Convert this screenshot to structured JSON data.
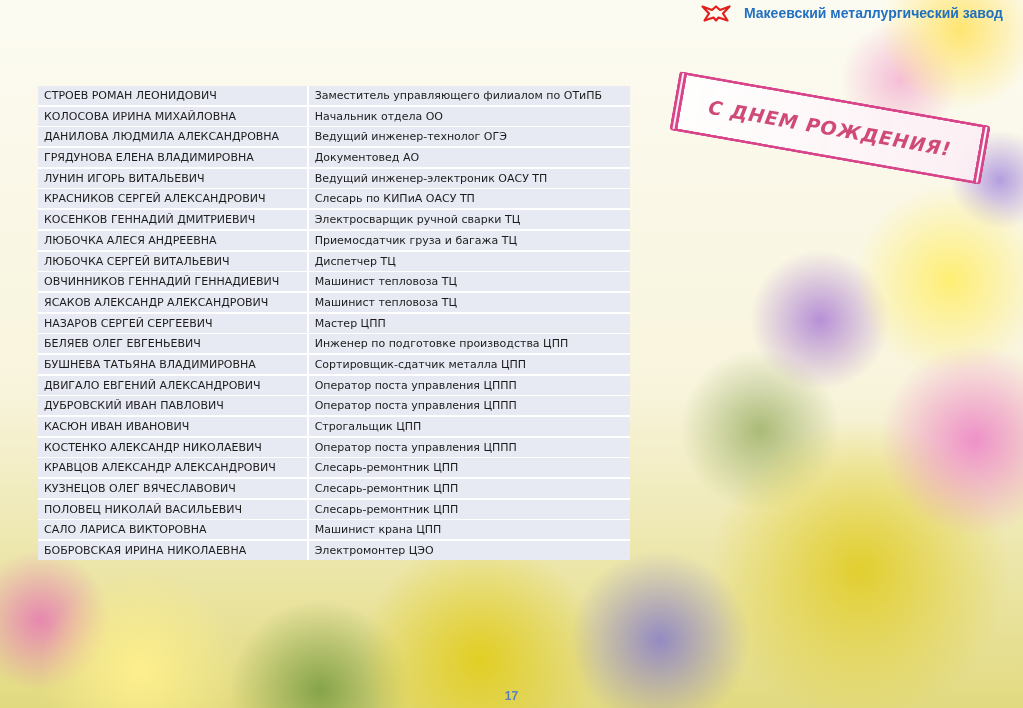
{
  "header": {
    "company": "Макеевский металлургический завод"
  },
  "table": {
    "rows": [
      {
        "name": "СТРОЕВ РОМАН ЛЕОНИДОВИЧ",
        "position": "Заместитель управляющего филиалом по ОТиПБ"
      },
      {
        "name": "КОЛОСОВА ИРИНА МИХАЙЛОВНА",
        "position": "Начальник отдела ОО"
      },
      {
        "name": "ДАНИЛОВА ЛЮДМИЛА АЛЕКСАНДРОВНА",
        "position": "Ведущий инженер-технолог ОГЭ"
      },
      {
        "name": "ГРЯДУНОВА ЕЛЕНА ВЛАДИМИРОВНА",
        "position": "Документовед АО"
      },
      {
        "name": "ЛУНИН ИГОРЬ ВИТАЛЬЕВИЧ",
        "position": "Ведущий инженер-электроник ОАСУ ТП"
      },
      {
        "name": "КРАСНИКОВ СЕРГЕЙ АЛЕКСАНДРОВИЧ",
        "position": "Слесарь по КИПиА ОАСУ ТП"
      },
      {
        "name": "КОСЕНКОВ ГЕННАДИЙ ДМИТРИЕВИЧ",
        "position": "Электросварщик ручной сварки ТЦ"
      },
      {
        "name": "ЛЮБОЧКА АЛЕСЯ АНДРЕЕВНА",
        "position": "Приемосдатчик груза и багажа ТЦ"
      },
      {
        "name": "ЛЮБОЧКА СЕРГЕЙ ВИТАЛЬЕВИЧ",
        "position": "Диспетчер ТЦ"
      },
      {
        "name": "ОВЧИННИКОВ ГЕННАДИЙ ГЕННАДИЕВИЧ",
        "position": "Машинист тепловоза ТЦ"
      },
      {
        "name": "ЯСАКОВ АЛЕКСАНДР АЛЕКСАНДРОВИЧ",
        "position": "Машинист тепловоза ТЦ"
      },
      {
        "name": "НАЗАРОВ СЕРГЕЙ СЕРГЕЕВИЧ",
        "position": "Мастер ЦПП"
      },
      {
        "name": "БЕЛЯЕВ ОЛЕГ ЕВГЕНЬЕВИЧ",
        "position": "Инженер по подготовке производства ЦПП"
      },
      {
        "name": "БУШНЕВА ТАТЬЯНА ВЛАДИМИРОВНА",
        "position": "Сортировщик-сдатчик металла ЦПП"
      },
      {
        "name": "ДВИГАЛО ЕВГЕНИЙ АЛЕКСАНДРОВИЧ",
        "position": "Оператор поста управления ЦППП"
      },
      {
        "name": "ДУБРОВСКИЙ ИВАН ПАВЛОВИЧ",
        "position": "Оператор поста управления ЦППП"
      },
      {
        "name": "КАСЮН ИВАН ИВАНОВИЧ",
        "position": "Строгальщик ЦПП"
      },
      {
        "name": "КОСТЕНКО АЛЕКСАНДР НИКОЛАЕВИЧ",
        "position": "Оператор поста управления ЦППП"
      },
      {
        "name": "КРАВЦОВ АЛЕКСАНДР АЛЕКСАНДРОВИЧ",
        "position": "Слесарь-ремонтник ЦПП"
      },
      {
        "name": "КУЗНЕЦОВ ОЛЕГ ВЯЧЕСЛАВОВИЧ",
        "position": "Слесарь-ремонтник ЦПП"
      },
      {
        "name": "ПОЛОВЕЦ НИКОЛАЙ ВАСИЛЬЕВИЧ",
        "position": "Слесарь-ремонтник ЦПП"
      },
      {
        "name": "САЛО ЛАРИСА ВИКТОРОВНА",
        "position": "Машинист крана ЦПП"
      },
      {
        "name": "БОБРОВСКАЯ ИРИНА НИКОЛАЕВНА",
        "position": "Электромонтер ЦЭО"
      }
    ]
  },
  "banner": {
    "title": "С ДНЕМ РОЖДЕНИЯ!"
  },
  "page_number": "17"
}
